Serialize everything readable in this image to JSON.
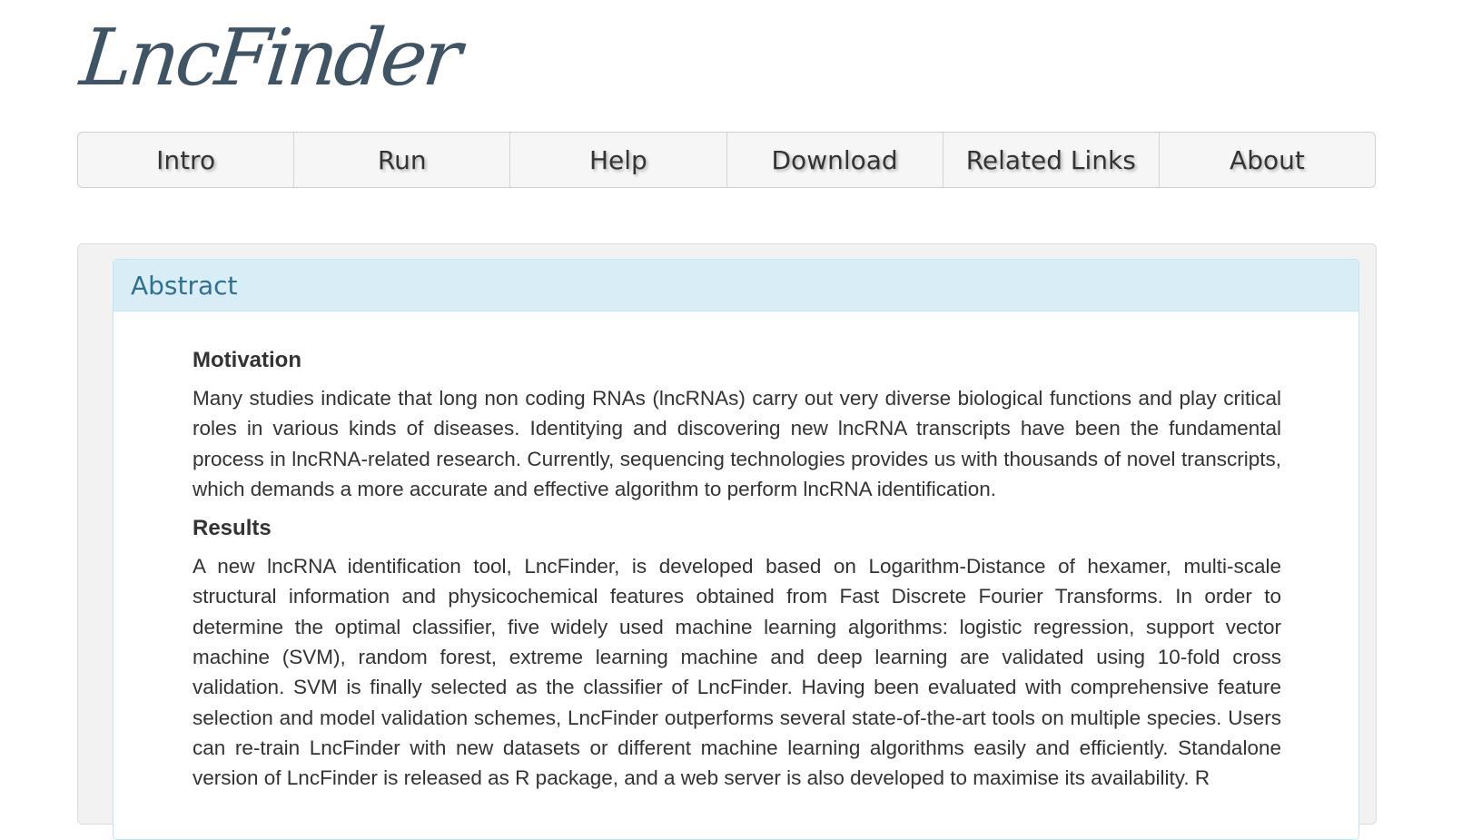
{
  "logo": {
    "text": "LncFinder"
  },
  "nav": {
    "items": [
      {
        "label": "Intro"
      },
      {
        "label": "Run"
      },
      {
        "label": "Help"
      },
      {
        "label": "Download"
      },
      {
        "label": "Related Links"
      },
      {
        "label": "About"
      }
    ]
  },
  "abstract": {
    "header": "Abstract",
    "motivation_title": "Motivation",
    "motivation_text": "Many studies indicate that long non coding RNAs (lncRNAs) carry out very diverse biological functions and play critical roles in various kinds of diseases. Identitying and discovering new lncRNA transcripts have been the fundamental process in lncRNA-related research. Currently, sequencing technologies provides us with thousands of novel transcripts, which demands a more accurate and effective algorithm to perform lncRNA identification.",
    "results_title": "Results",
    "results_text": "A new lncRNA identification tool, LncFinder, is developed based on Logarithm-Distance of hexamer, multi-scale structural information and physicochemical features obtained from Fast Discrete Fourier Transforms. In order to determine the optimal classifier, five widely used machine learning algorithms: logistic regression, support vector machine (SVM), random forest, extreme learning machine and deep learning are validated using 10-fold cross validation. SVM is finally selected as the classifier of LncFinder. Having been evaluated with comprehensive feature selection and model validation schemes, LncFinder outperforms several state-of-the-art tools on multiple species. Users can re-train LncFinder with new datasets or different machine learning algorithms easily and efficiently. Standalone version of LncFinder is released as R package, and a web server is also developed to maximise its availability. R"
  }
}
